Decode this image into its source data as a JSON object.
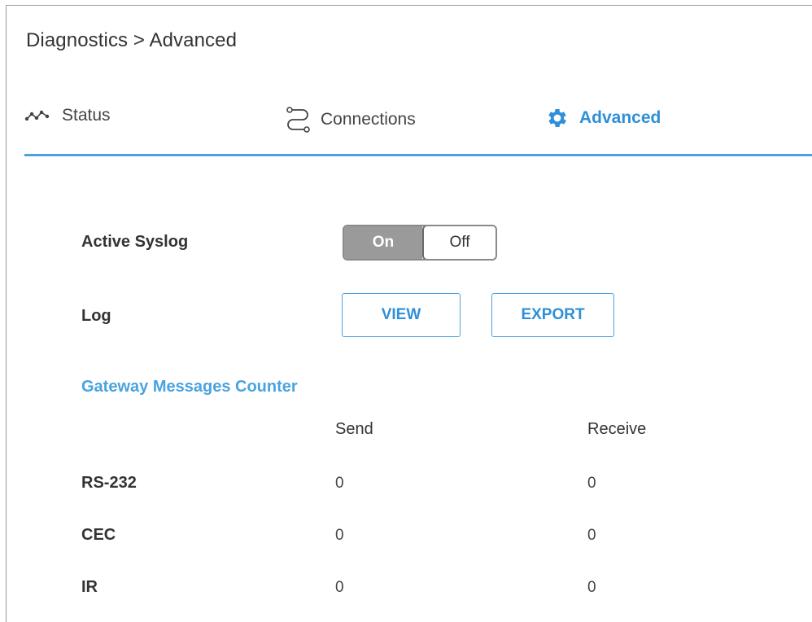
{
  "breadcrumb": "Diagnostics > Advanced",
  "tabs": [
    {
      "label": "Status",
      "icon": "status-wave-icon",
      "active": false
    },
    {
      "label": "Connections",
      "icon": "connections-route-icon",
      "active": false
    },
    {
      "label": "Advanced",
      "icon": "gear-icon",
      "active": true
    }
  ],
  "colors": {
    "accent": "#4aa3df",
    "accent_text": "#2f8fd8",
    "toggle_on_bg": "#9a9a9a"
  },
  "syslog": {
    "label": "Active Syslog",
    "on_label": "On",
    "off_label": "Off",
    "selected": "Off"
  },
  "log": {
    "label": "Log",
    "view_label": "VIEW",
    "export_label": "EXPORT"
  },
  "counter": {
    "title": "Gateway Messages Counter",
    "columns": [
      "Send",
      "Receive"
    ],
    "rows": [
      {
        "label": "RS-232",
        "send": "0",
        "receive": "0"
      },
      {
        "label": "CEC",
        "send": "0",
        "receive": "0"
      },
      {
        "label": "IR",
        "send": "0",
        "receive": "0"
      }
    ]
  }
}
